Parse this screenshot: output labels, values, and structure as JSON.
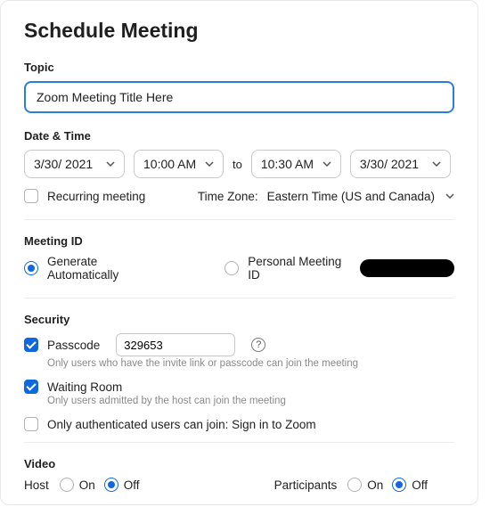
{
  "header": {
    "title": "Schedule Meeting"
  },
  "topic": {
    "label": "Topic",
    "value": "Zoom Meeting Title Here"
  },
  "datetime": {
    "label": "Date & Time",
    "start_date": "3/30/ 2021",
    "start_time": "10:00 AM",
    "to_label": "to",
    "end_time": "10:30 AM",
    "end_date": "3/30/ 2021",
    "recurring_label": "Recurring meeting",
    "recurring_checked": "false",
    "timezone_label": "Time Zone:",
    "timezone_value": "Eastern Time (US and Canada)"
  },
  "meeting_id": {
    "label": "Meeting ID",
    "generate_label": "Generate Automatically",
    "personal_label": "Personal Meeting ID",
    "selected": "generate"
  },
  "security": {
    "label": "Security",
    "passcode_label": "Passcode",
    "passcode_value": "329653",
    "passcode_desc": "Only users who have the invite link or passcode can join the meeting",
    "waiting_label": "Waiting Room",
    "waiting_desc": "Only users admitted by the host can join the meeting",
    "auth_label": "Only authenticated users can join: Sign in to Zoom",
    "passcode_checked": "true",
    "waiting_checked": "true",
    "auth_checked": "false"
  },
  "video": {
    "label": "Video",
    "host_label": "Host",
    "participants_label": "Participants",
    "on_label": "On",
    "off_label": "Off",
    "host_state": "off",
    "participants_state": "off"
  }
}
